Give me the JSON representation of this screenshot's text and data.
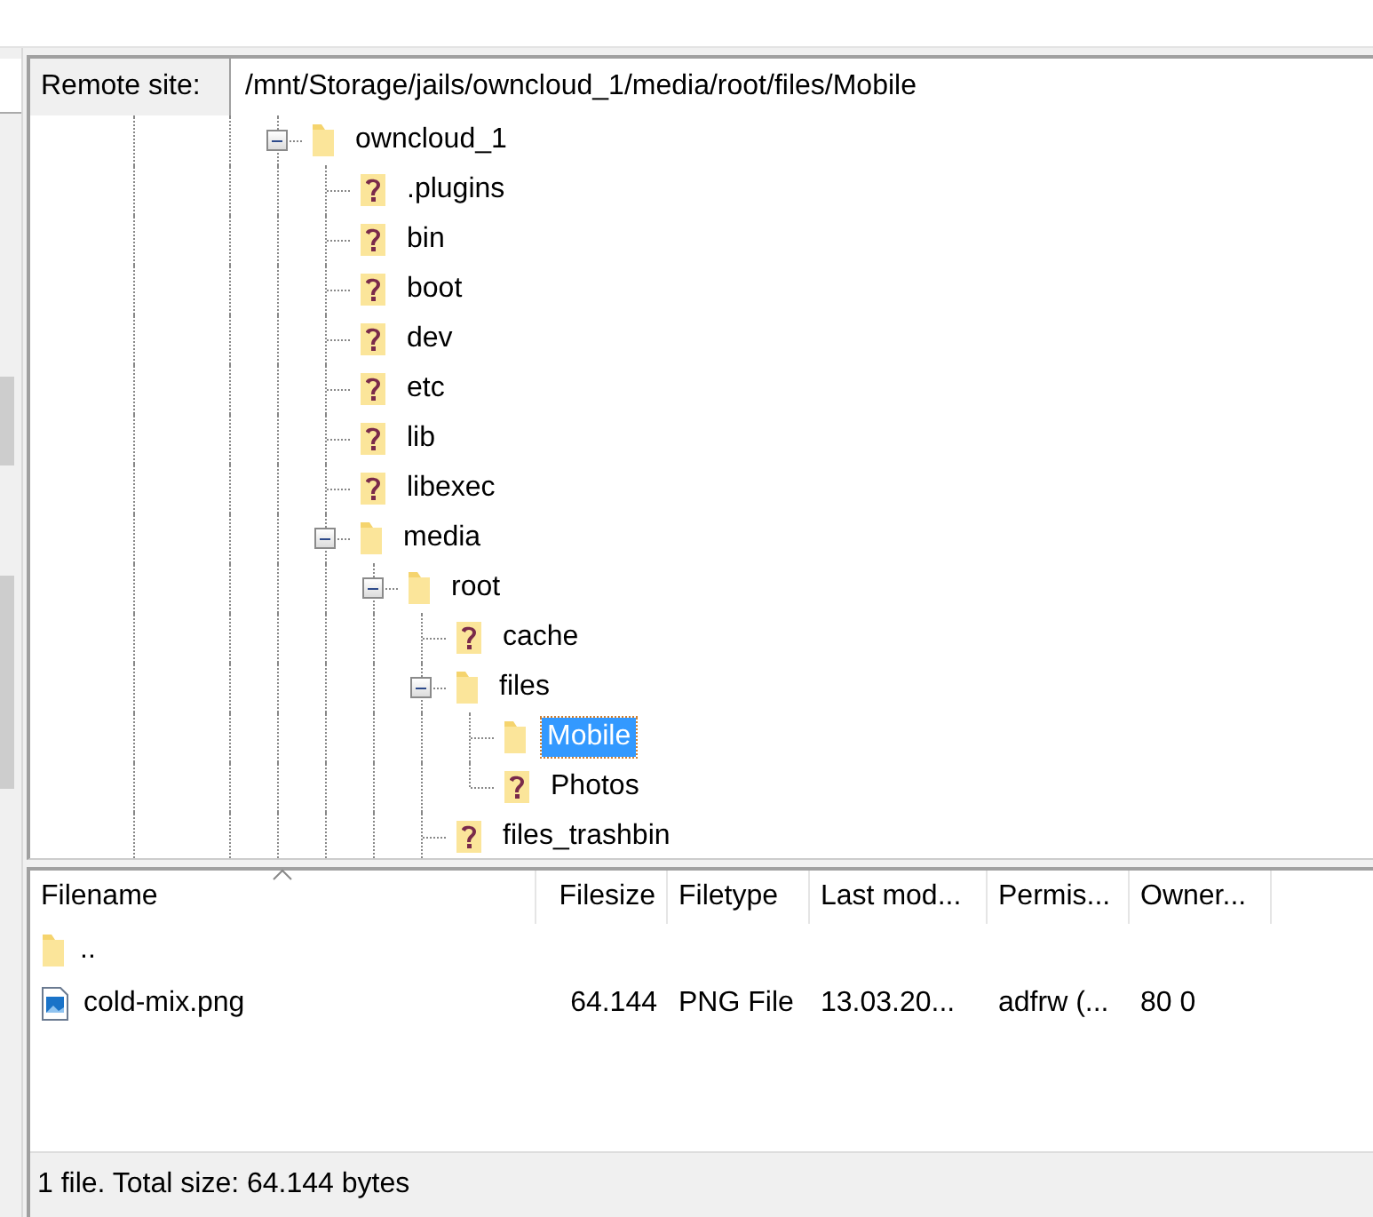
{
  "remote_site": {
    "label": "Remote site:",
    "path": "/mnt/Storage/jails/owncloud_1/media/root/files/Mobile"
  },
  "tree": [
    {
      "label": "owncloud_1",
      "kind": "folder",
      "selected": false,
      "expanded": true,
      "children": [
        {
          "label": ".plugins",
          "kind": "unknown",
          "selected": false
        },
        {
          "label": "bin",
          "kind": "unknown",
          "selected": false
        },
        {
          "label": "boot",
          "kind": "unknown",
          "selected": false
        },
        {
          "label": "dev",
          "kind": "unknown",
          "selected": false
        },
        {
          "label": "etc",
          "kind": "unknown",
          "selected": false
        },
        {
          "label": "lib",
          "kind": "unknown",
          "selected": false
        },
        {
          "label": "libexec",
          "kind": "unknown",
          "selected": false
        },
        {
          "label": "media",
          "kind": "folder",
          "selected": false,
          "expanded": true,
          "children": [
            {
              "label": "root",
              "kind": "folder",
              "selected": false,
              "expanded": true,
              "children": [
                {
                  "label": "cache",
                  "kind": "unknown",
                  "selected": false
                },
                {
                  "label": "files",
                  "kind": "folder",
                  "selected": false,
                  "expanded": true,
                  "children": [
                    {
                      "label": "Mobile",
                      "kind": "folder",
                      "selected": true
                    },
                    {
                      "label": "Photos",
                      "kind": "unknown",
                      "selected": false
                    }
                  ]
                },
                {
                  "label": "files_trashbin",
                  "kind": "unknown",
                  "selected": false
                }
              ]
            }
          ]
        }
      ]
    }
  ],
  "file_list": {
    "columns": [
      {
        "label": "Filename",
        "sorted": true
      },
      {
        "label": "Filesize",
        "sorted": false
      },
      {
        "label": "Filetype",
        "sorted": false
      },
      {
        "label": "Last mod...",
        "sorted": false
      },
      {
        "label": "Permis...",
        "sorted": false
      },
      {
        "label": "Owner...",
        "sorted": false
      }
    ],
    "rows": [
      {
        "kind": "folder",
        "cells": [
          ".."
        ]
      },
      {
        "kind": "image",
        "cells": [
          "cold-mix.png",
          "64.144",
          "PNG File",
          "13.03.20...",
          "adfrw (...",
          "80 0"
        ]
      }
    ]
  },
  "status_bar": "1 file. Total size: 64.144 bytes"
}
